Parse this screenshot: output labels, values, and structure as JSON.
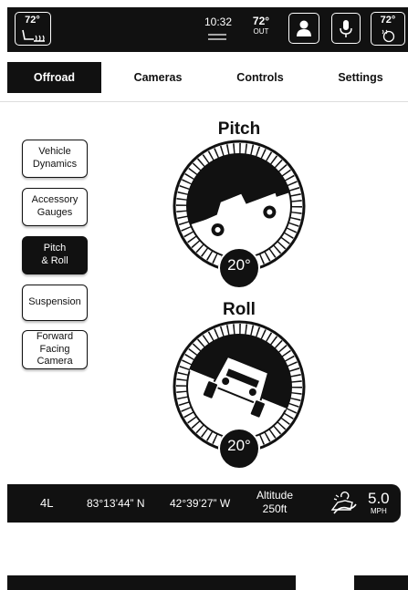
{
  "top_bar": {
    "left_temp": "72°",
    "time": "10:32",
    "out_temp": "72°",
    "out_label": "OUT",
    "right_temp": "72°",
    "icons": [
      "seat-heat-icon",
      "menu-lines-icon",
      "profile-icon",
      "microphone-icon",
      "heated-wheel-icon"
    ]
  },
  "tabs": [
    {
      "label": "Offroad",
      "active": true
    },
    {
      "label": "Cameras",
      "active": false
    },
    {
      "label": "Controls",
      "active": false
    },
    {
      "label": "Settings",
      "active": false
    }
  ],
  "side_menu": [
    {
      "label": "Vehicle\nDynamics",
      "active": false
    },
    {
      "label": "Accessory\nGauges",
      "active": false
    },
    {
      "label": "Pitch\n& Roll",
      "active": true
    },
    {
      "label": "Suspension",
      "active": false
    },
    {
      "label": "Forward\nFacing\nCamera",
      "active": false
    }
  ],
  "pitch": {
    "title": "Pitch",
    "angle_label": "20°",
    "angle": 20
  },
  "roll": {
    "title": "Roll",
    "angle_label": "20°",
    "angle": 20
  },
  "status_bar": {
    "gear": "4L",
    "latitude": "83°13’44” N",
    "longitude": "42°39’27” W",
    "altitude_label": "Altitude",
    "altitude_value": "250ft",
    "speed": "5.0",
    "speed_unit": "MPH",
    "icon": "offroad-vehicle-icon"
  },
  "colors": {
    "primary": "#111111",
    "background": "#ffffff"
  }
}
